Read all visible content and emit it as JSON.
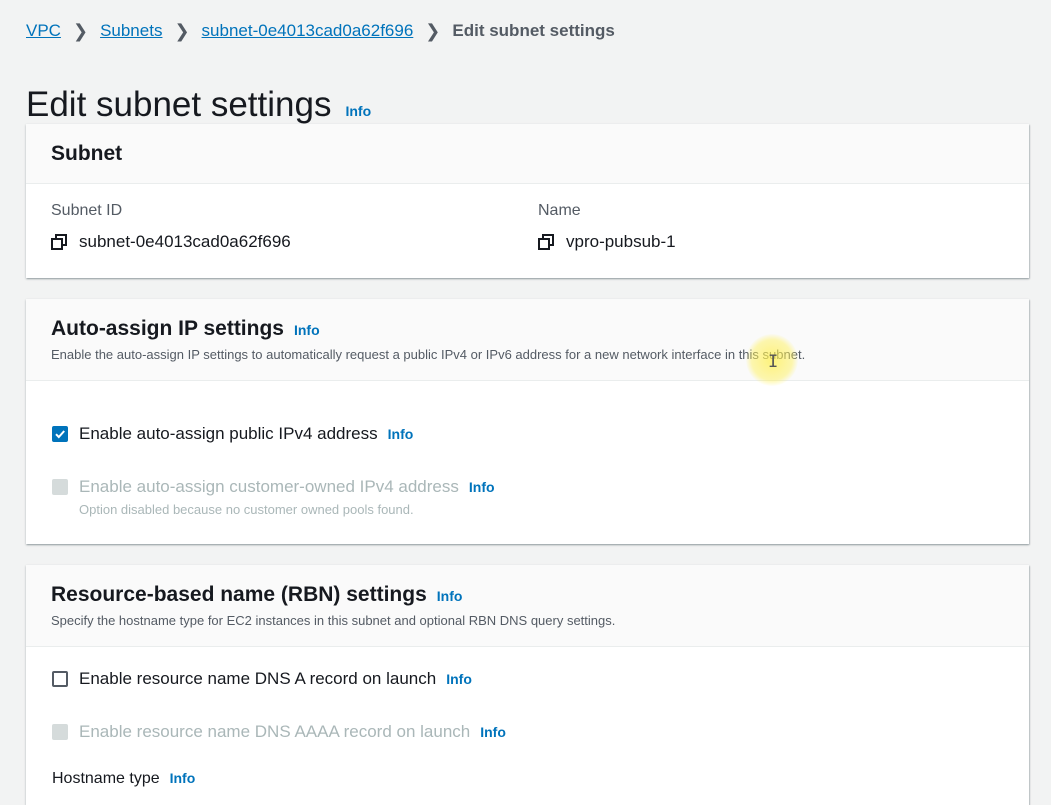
{
  "breadcrumb": {
    "items": [
      "VPC",
      "Subnets",
      "subnet-0e4013cad0a62f696"
    ],
    "current": "Edit subnet settings"
  },
  "page": {
    "title": "Edit subnet settings",
    "info": "Info"
  },
  "subnet_card": {
    "title": "Subnet",
    "subnet_id_label": "Subnet ID",
    "subnet_id_value": "subnet-0e4013cad0a62f696",
    "name_label": "Name",
    "name_value": "vpro-pubsub-1"
  },
  "auto_assign_card": {
    "title": "Auto-assign IP settings",
    "info": "Info",
    "description": "Enable the auto-assign IP settings to automatically request a public IPv4 or IPv6 address for a new network interface in this subnet.",
    "ipv4_label": "Enable auto-assign public IPv4 address",
    "ipv4_checked": true,
    "ipv4_info": "Info",
    "customer_owned_label": "Enable auto-assign customer-owned IPv4 address",
    "customer_owned_info": "Info",
    "customer_owned_help": "Option disabled because no customer owned pools found."
  },
  "rbn_card": {
    "title": "Resource-based name (RBN) settings",
    "info": "Info",
    "description": "Specify the hostname type for EC2 instances in this subnet and optional RBN DNS query settings.",
    "dns_a_label": "Enable resource name DNS A record on launch",
    "dns_a_checked": false,
    "dns_a_info": "Info",
    "dns_aaaa_label": "Enable resource name DNS AAAA record on launch",
    "dns_aaaa_info": "Info",
    "hostname_type_label": "Hostname type",
    "hostname_type_info": "Info"
  },
  "colors": {
    "link": "#0073bb",
    "checked": "#0073bb",
    "background": "#f2f3f3"
  },
  "icons": {
    "copy": "copy-icon",
    "check": "checkmark-icon",
    "separator": "chevron-right-icon"
  }
}
